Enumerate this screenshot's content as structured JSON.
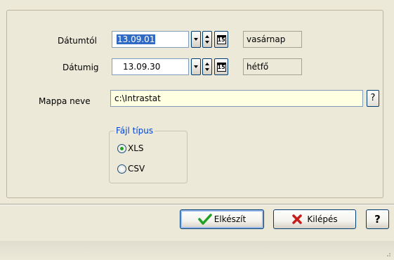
{
  "dates": {
    "from_label": "Dátumtól",
    "from_value": "13.09.01",
    "from_day": "vasárnap",
    "to_label": "Dátumig",
    "to_value": "13.09.30",
    "to_day": "hétfő",
    "calendar_icon_text": "15"
  },
  "folder": {
    "label": "Mappa neve",
    "value": "c:\\Intrastat",
    "help_label": "?"
  },
  "file_type": {
    "legend": "Fájl típus",
    "options": [
      {
        "label": "XLS",
        "selected": true
      },
      {
        "label": "CSV",
        "selected": false
      }
    ]
  },
  "buttons": {
    "create_label": "Elkészít",
    "exit_label": "Kilépés",
    "help_label": "?"
  },
  "colors": {
    "dialog_bg": "#ece9d8",
    "field_highlight": "#ffffe1",
    "selection": "#316ac5",
    "legend_text": "#0046d5",
    "check_green": "#21a121",
    "cross_red": "#c81c1c"
  }
}
